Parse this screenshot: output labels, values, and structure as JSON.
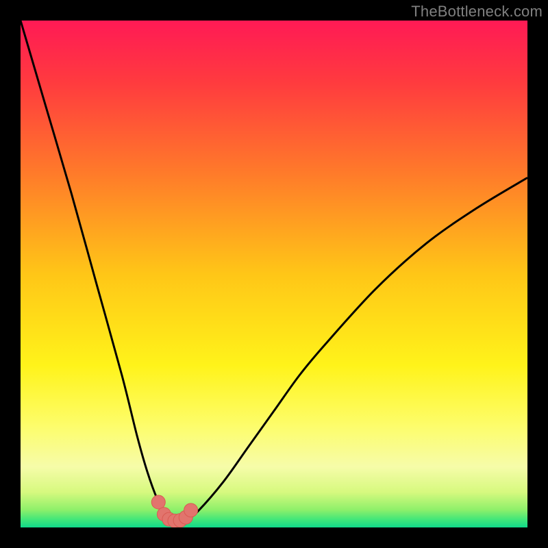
{
  "watermark": "TheBottleneck.com",
  "colors": {
    "frame": "#000000",
    "watermark": "#808080",
    "curve": "#000000",
    "markers_fill": "#e2746d",
    "markers_stroke": "#d85a52",
    "gradient_stops": [
      {
        "offset": 0.0,
        "color": "#ff1a55"
      },
      {
        "offset": 0.12,
        "color": "#ff3a3f"
      },
      {
        "offset": 0.3,
        "color": "#ff7a2a"
      },
      {
        "offset": 0.5,
        "color": "#ffc617"
      },
      {
        "offset": 0.68,
        "color": "#fff31a"
      },
      {
        "offset": 0.8,
        "color": "#fdfd6b"
      },
      {
        "offset": 0.88,
        "color": "#f6fca9"
      },
      {
        "offset": 0.93,
        "color": "#d7f97f"
      },
      {
        "offset": 0.965,
        "color": "#8ef06a"
      },
      {
        "offset": 0.985,
        "color": "#3fe67a"
      },
      {
        "offset": 1.0,
        "color": "#10d98a"
      }
    ]
  },
  "chart_data": {
    "type": "line",
    "title": "",
    "xlabel": "",
    "ylabel": "",
    "xlim": [
      0,
      100
    ],
    "ylim": [
      0,
      100
    ],
    "series": [
      {
        "name": "bottleneck-curve",
        "x": [
          0,
          5,
          10,
          15,
          20,
          23,
          25,
          27,
          28.5,
          30,
          31.5,
          33,
          35,
          40,
          45,
          50,
          55,
          60,
          70,
          80,
          90,
          100
        ],
        "y": [
          100,
          83,
          66,
          48,
          30,
          18,
          11,
          5.5,
          2.8,
          1.5,
          1.3,
          1.7,
          3.2,
          9,
          16,
          23,
          30,
          36,
          47,
          56,
          63,
          69
        ]
      }
    ],
    "markers": {
      "name": "highlight-dots",
      "x": [
        27.2,
        28.3,
        29.3,
        30.4,
        31.5,
        32.6,
        33.6
      ],
      "y": [
        5.0,
        2.6,
        1.6,
        1.3,
        1.4,
        2.0,
        3.4
      ]
    }
  }
}
